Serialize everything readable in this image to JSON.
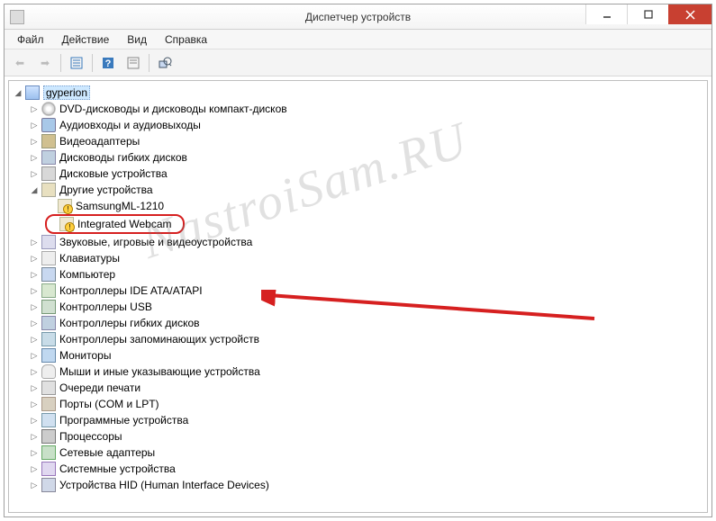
{
  "window": {
    "title": "Диспетчер устройств"
  },
  "menu": {
    "file": "Файл",
    "action": "Действие",
    "view": "Вид",
    "help": "Справка"
  },
  "watermark": "NastroiSam.RU",
  "tree": {
    "root": {
      "label": "gyperion",
      "expanded": true
    },
    "items": [
      {
        "label": "DVD-дисководы и дисководы компакт-дисков",
        "icon": "ic-disc"
      },
      {
        "label": "Аудиовходы и аудиовыходы",
        "icon": "ic-audio"
      },
      {
        "label": "Видеоадаптеры",
        "icon": "ic-video"
      },
      {
        "label": "Дисководы гибких дисков",
        "icon": "ic-floppy"
      },
      {
        "label": "Дисковые устройства",
        "icon": "ic-hdd"
      },
      {
        "label": "Другие устройства",
        "icon": "ic-other",
        "expanded": true,
        "children": [
          {
            "label": "SamsungML-1210",
            "icon": "ic-warn"
          },
          {
            "label": "Integrated Webcam",
            "icon": "ic-warn",
            "highlighted": true
          }
        ]
      },
      {
        "label": "Звуковые, игровые и видеоустройства",
        "icon": "ic-sound"
      },
      {
        "label": "Клавиатуры",
        "icon": "ic-kbd"
      },
      {
        "label": "Компьютер",
        "icon": "ic-pc"
      },
      {
        "label": "Контроллеры IDE ATA/ATAPI",
        "icon": "ic-ide"
      },
      {
        "label": "Контроллеры USB",
        "icon": "ic-usb"
      },
      {
        "label": "Контроллеры гибких дисков",
        "icon": "ic-floppy"
      },
      {
        "label": "Контроллеры запоминающих устройств",
        "icon": "ic-storage"
      },
      {
        "label": "Мониторы",
        "icon": "ic-monitor"
      },
      {
        "label": "Мыши и иные указывающие устройства",
        "icon": "ic-mouse"
      },
      {
        "label": "Очереди печати",
        "icon": "ic-queue"
      },
      {
        "label": "Порты (COM и LPT)",
        "icon": "ic-port"
      },
      {
        "label": "Программные устройства",
        "icon": "ic-sw"
      },
      {
        "label": "Процессоры",
        "icon": "ic-cpu"
      },
      {
        "label": "Сетевые адаптеры",
        "icon": "ic-net"
      },
      {
        "label": "Системные устройства",
        "icon": "ic-sys"
      },
      {
        "label": "Устройства HID (Human Interface Devices)",
        "icon": "ic-hid"
      }
    ]
  }
}
